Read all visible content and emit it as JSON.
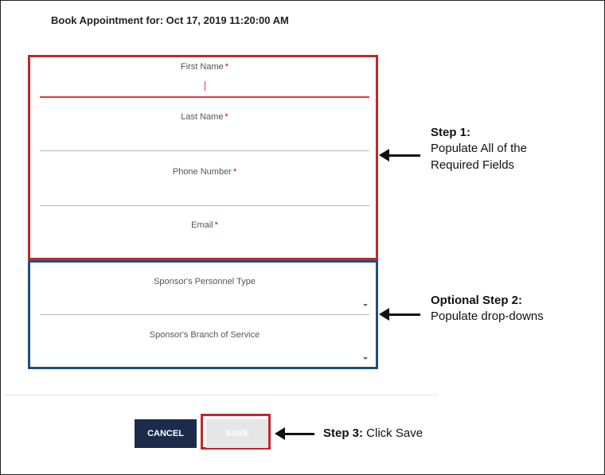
{
  "header": {
    "title": "Book Appointment for: Oct 17, 2019 11:20:00 AM"
  },
  "form": {
    "required_fields": [
      {
        "label": "First Name",
        "required_mark": "*",
        "value": ""
      },
      {
        "label": "Last Name",
        "required_mark": "*",
        "value": ""
      },
      {
        "label": "Phone Number",
        "required_mark": "*",
        "value": ""
      },
      {
        "label": "Email",
        "required_mark": "*",
        "value": ""
      }
    ],
    "dropdowns": [
      {
        "label": "Sponsor's Personnel Type",
        "value": ""
      },
      {
        "label": "Sponsor's Branch of Service",
        "value": ""
      }
    ]
  },
  "buttons": {
    "cancel": "CANCEL",
    "save": "SAVE"
  },
  "annotations": {
    "step1_title": "Step 1:",
    "step1_line1": "Populate All of the",
    "step1_line2": "Required Fields",
    "step2_title": "Optional Step 2:",
    "step2_line1": "Populate drop-downs",
    "step3_title": "Step 3:",
    "step3_text": " Click Save"
  },
  "colors": {
    "required_box": "#c0282d",
    "optional_box": "#1f4e79",
    "cancel_button": "#1c2b4a",
    "active_field": "#e53935"
  }
}
